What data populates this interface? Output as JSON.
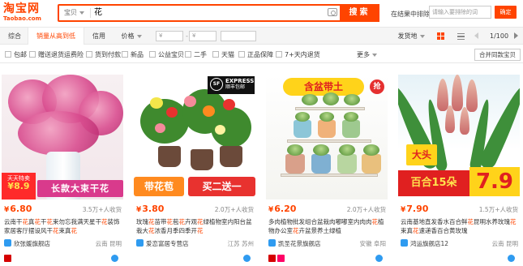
{
  "header": {
    "logo_cn": "淘宝网",
    "logo_en": "Taobao.com",
    "search_scope": "宝贝",
    "search_query": "花",
    "search_button": "搜索",
    "in_result_label": "在结果中排除",
    "in_result_placeholder": "请输入要排除的词",
    "confirm_label": "确定"
  },
  "sortbar": {
    "items": [
      "综合",
      "销量从高到低",
      "信用",
      "价格"
    ],
    "active_index": 1,
    "price_from": "¥",
    "price_to": "¥",
    "ship_from": "发货地",
    "page": "1/100"
  },
  "filters": {
    "items": [
      "包邮",
      "赠送退货运费险",
      "货到付款",
      "新品",
      "公益宝贝",
      "二手",
      "天猫",
      "正品保障",
      "7+天内退货"
    ],
    "more": "更多",
    "merge": "合并同款宝贝"
  },
  "products": [
    {
      "price": "6.80",
      "sales": "3.5万+人收货",
      "title_html": "云南干<span class='hl'>花</span>真<span class='hl'>花</span>干<span class='hl'>花</span>束勿忘我满天星干<span class='hl'>花</span>装饰家居客厅摆设风干<span class='hl'>花</span>束真<span class='hl'>花</span>",
      "shop": "欣张媛旗舰店",
      "location": "云南 昆明",
      "promo_small": "天天特卖",
      "promo_price": "8.9",
      "promo_bar": "长款大束干花"
    },
    {
      "price": "3.80",
      "sales": "2.0万+人收货",
      "title_html": "玫瑰<span class='hl'>花</span>苗带<span class='hl'>花</span>苞<span class='hl'>花</span>卉观<span class='hl'>花</span>绿植物室内阳台盆栽大<span class='hl'>花</span>浓香月季四季开<span class='hl'>花</span>",
      "shop": "爱恋富居专营店",
      "location": "江苏 苏州",
      "express_top": "EXPRESS",
      "express_bottom": "顺丰包邮",
      "tag_left": "带花苞",
      "tag_right": "买二送一"
    },
    {
      "price": "6.20",
      "sales": "2.0万+人收货",
      "title_html": "多肉植物批发组合盆栽肉嘟嘟室内肉肉<span class='hl'>花</span>植物办公室<span class='hl'>花</span>卉盆景养土绿植",
      "shop": "凯圣花景旗舰店",
      "location": "安徽 阜阳",
      "tag_top": "含盆带土",
      "tag_circle": "抢"
    },
    {
      "price": "7.90",
      "sales": "1.5万+人收货",
      "title_html": "云南基地直发香水百合鲜<span class='hl'>花</span>昆明水养玫瑰<span class='hl'>花</span>束真<span class='hl'>花</span>速递香百合黄玫瑰",
      "shop": "鸿运旗舰店12",
      "location": "云南 昆明",
      "tag_big": "大头",
      "tag_count": "百合15朵",
      "tag_price": "7.9"
    }
  ]
}
